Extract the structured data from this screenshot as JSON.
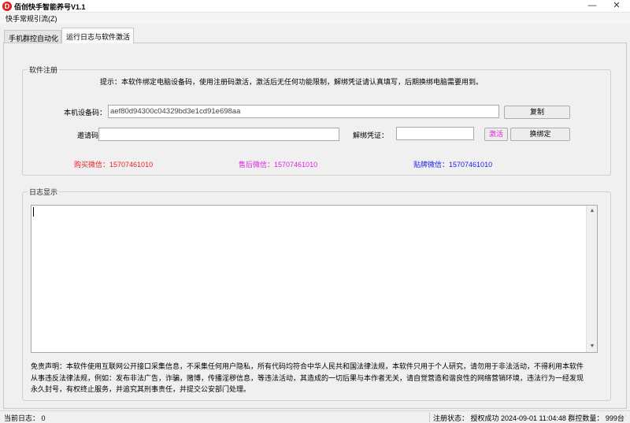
{
  "window": {
    "title": "佰创快手智能养号V1.1",
    "icon_letter": "D",
    "minimize_glyph": "—",
    "close_glyph": "✕"
  },
  "menu": {
    "items": [
      "快手常规引流(Z)"
    ]
  },
  "tabs": [
    {
      "label": "手机群控自动化",
      "active": false
    },
    {
      "label": "运行日志与软件激活",
      "active": true
    }
  ],
  "registration": {
    "group_title": "软件注册",
    "hint": "提示：本软件绑定电脑设备码，使用注册码激活，激活后无任何功能限制，解绑凭证请认真填写，后期换绑电脑需要用到。",
    "device_code_label": "本机设备码：",
    "device_code_value": "aef80d94300c04329bd3e1cd91e698aa",
    "copy_button": "复制",
    "invite_code_label": "邀请码：",
    "invite_code_value": "",
    "unbind_label": "解绑凭证：",
    "unbind_value": "",
    "activate_button": "激活",
    "rebind_button": "换绑定",
    "contacts": [
      {
        "label": "购买微信：",
        "value": "15707461010",
        "color": "#e8212b"
      },
      {
        "label": "售后微信：",
        "value": "15707461010",
        "color": "#e020e0"
      },
      {
        "label": "贴牌微信：",
        "value": "15707461010",
        "color": "#2020e8"
      }
    ]
  },
  "log": {
    "group_title": "日志显示",
    "content": "",
    "disclaimer_lines": [
      "免责声明：本软件使用互联网公开接口采集信息，不采集任何用户隐私，所有代码均符合中华人民共和国法律法规，本软件只用于个人研究，请勿用于非法活动，不得利用本软件",
      "从事违反法律法规，例如：发布非法广告，诈骗，赌博，传播淫秽信息，等违法活动，其造成的一切后果与本作者无关，请自觉营造和谐良性的网络营销环境，违法行为一经发现",
      "永久封号，有权终止服务，并追究其刑事责任，并提交公安部门处理。"
    ]
  },
  "status": {
    "left": "当前日志：  0",
    "right": "注册状态：  授权成功  2024-09-01 11:04:48  群控数量：  999台"
  },
  "colors": {
    "activate_text": "#e020e0",
    "app_icon_bg": "#d81e1e"
  }
}
